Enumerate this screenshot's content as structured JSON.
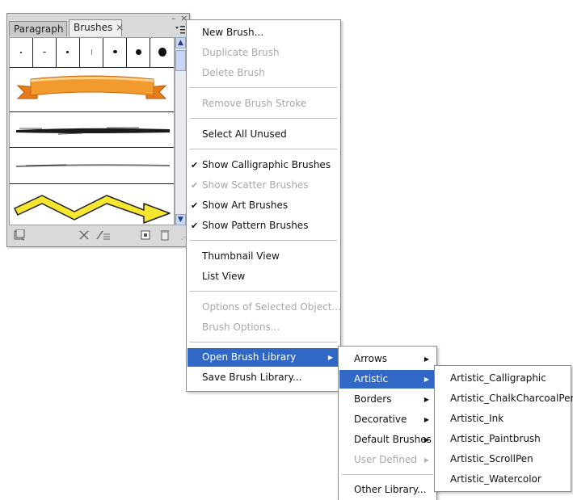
{
  "panel": {
    "tabs": [
      {
        "label": "Paragraph"
      },
      {
        "label": "Brushes",
        "close": "×"
      }
    ],
    "minimize_glyph": "–",
    "close_glyph": "×",
    "menu_icon": "panel-menu-icon",
    "scroll_up": "▲",
    "scroll_down": "▼",
    "brush_names": [
      "calligraphic-brushes",
      "banner-art-brush",
      "charcoal-art-brush",
      "thin-art-brush",
      "zigzag-arrow-art-brush"
    ],
    "bottom_icons": [
      "brush-libraries-icon",
      "remove-brush-stroke-icon",
      "options-icon",
      "new-brush-icon",
      "delete-brush-icon"
    ]
  },
  "colors": {
    "highlight": "#3168c6",
    "banner_fill": "#f29a2e",
    "arrow_fill": "#f6e630"
  },
  "main_menu": {
    "items": [
      {
        "label": "New Brush...",
        "disabled": false
      },
      {
        "label": "Duplicate Brush",
        "disabled": true
      },
      {
        "label": "Delete Brush",
        "disabled": true
      },
      {
        "label": "Remove Brush Stroke",
        "disabled": true
      },
      {
        "label": "Select All Unused",
        "disabled": false
      },
      {
        "label": "Show Calligraphic Brushes",
        "disabled": false,
        "checked": true
      },
      {
        "label": "Show Scatter Brushes",
        "disabled": true,
        "checked": true
      },
      {
        "label": "Show Art Brushes",
        "disabled": false,
        "checked": true
      },
      {
        "label": "Show Pattern Brushes",
        "disabled": false,
        "checked": true
      },
      {
        "label": "Thumbnail View",
        "disabled": false
      },
      {
        "label": "List View",
        "disabled": false
      },
      {
        "label": "Options of Selected Object...",
        "disabled": true
      },
      {
        "label": "Brush Options...",
        "disabled": true
      },
      {
        "label": "Open Brush Library",
        "disabled": false,
        "submenu": true,
        "highlighted": true
      },
      {
        "label": "Save Brush Library...",
        "disabled": false
      }
    ]
  },
  "library_menu": {
    "items": [
      {
        "label": "Arrows",
        "disabled": false,
        "submenu": true
      },
      {
        "label": "Artistic",
        "disabled": false,
        "submenu": true,
        "highlighted": true
      },
      {
        "label": "Borders",
        "disabled": false,
        "submenu": true
      },
      {
        "label": "Decorative",
        "disabled": false,
        "submenu": true
      },
      {
        "label": "Default Brushes",
        "disabled": false,
        "submenu": true
      },
      {
        "label": "User Defined",
        "disabled": true,
        "submenu": true
      },
      {
        "label": "Other Library...",
        "disabled": false
      }
    ]
  },
  "artistic_menu": {
    "items": [
      {
        "label": "Artistic_Calligraphic"
      },
      {
        "label": "Artistic_ChalkCharcoalPencil"
      },
      {
        "label": "Artistic_Ink"
      },
      {
        "label": "Artistic_Paintbrush"
      },
      {
        "label": "Artistic_ScrollPen"
      },
      {
        "label": "Artistic_Watercolor"
      }
    ]
  }
}
